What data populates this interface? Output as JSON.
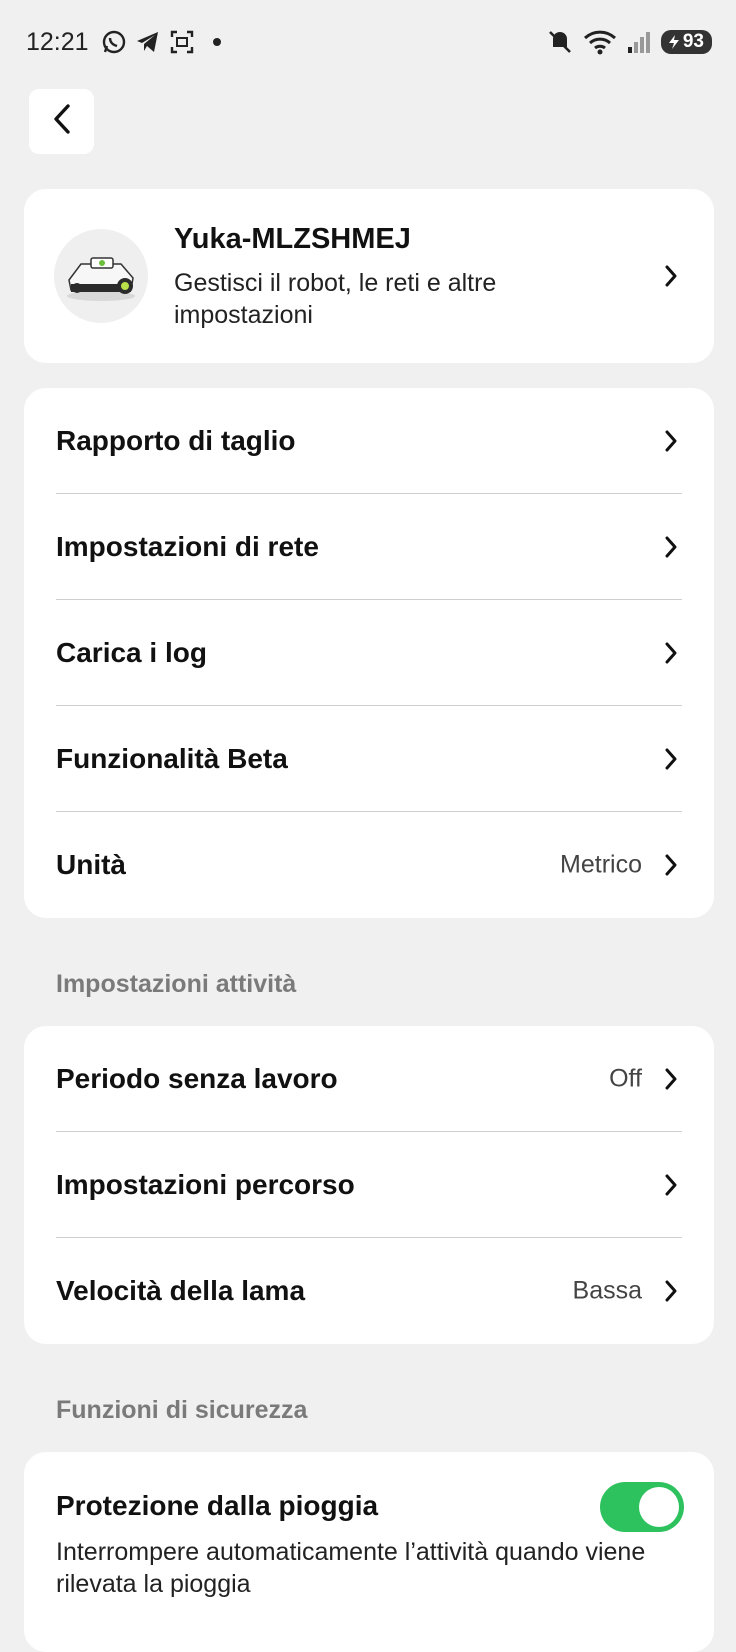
{
  "status_bar": {
    "time": "12:21",
    "battery": "93",
    "left_icons": [
      "whatsapp-icon",
      "telegram-icon",
      "screenshot-icon"
    ],
    "right_icons": [
      "mute-icon",
      "wifi-icon",
      "signal-icon",
      "battery-icon"
    ]
  },
  "header": {
    "back_icon": "chevron-left-icon"
  },
  "robot": {
    "name": "Yuka-MLZSHMEJ",
    "description": "Gestisci il robot, le reti e altre impostazioni"
  },
  "general_menu": [
    {
      "label": "Rapporto di taglio",
      "value": ""
    },
    {
      "label": "Impostazioni di rete",
      "value": ""
    },
    {
      "label": "Carica i log",
      "value": ""
    },
    {
      "label": "Funzionalità Beta",
      "value": ""
    },
    {
      "label": "Unità",
      "value": "Metrico"
    }
  ],
  "activity_section": {
    "title": "Impostazioni attività",
    "items": [
      {
        "label": "Periodo senza lavoro",
        "value": "Off"
      },
      {
        "label": "Impostazioni percorso",
        "value": ""
      },
      {
        "label": "Velocità della lama",
        "value": "Bassa"
      }
    ]
  },
  "safety_section": {
    "title": "Funzioni di sicurezza",
    "rain_protection": {
      "title": "Protezione dalla pioggia",
      "description": "Interrompere automaticamente l’attività quando viene rilevata la pioggia",
      "enabled": true
    }
  },
  "colors": {
    "background": "#f0f0f0",
    "card": "#ffffff",
    "toggle_on": "#2ec25f",
    "section_title": "#7a7a7a"
  }
}
